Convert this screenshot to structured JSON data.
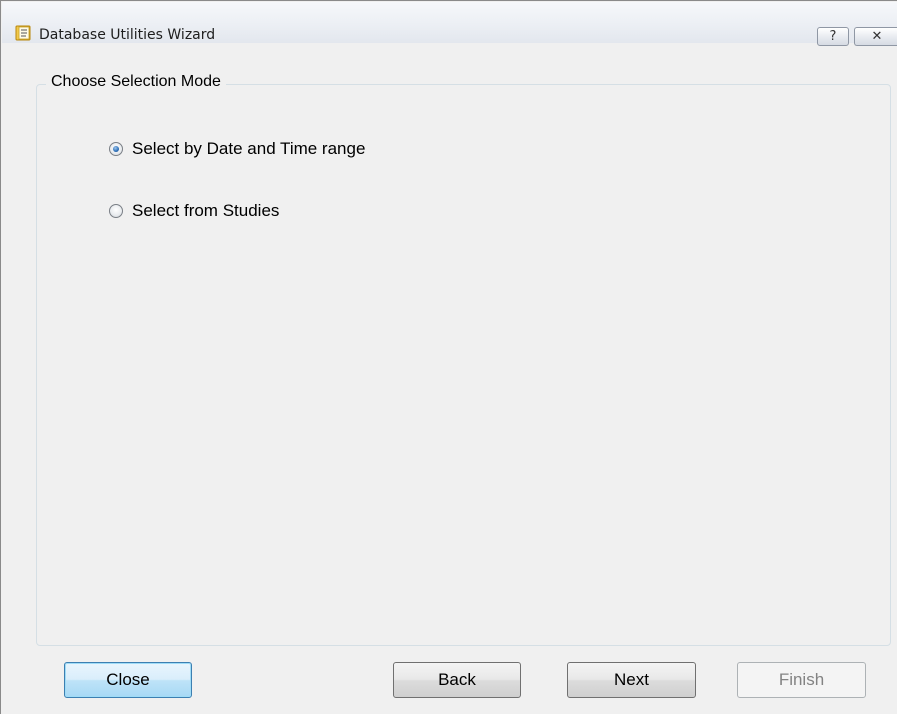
{
  "window": {
    "title": "Database Utilities Wizard",
    "help_glyph": "?",
    "close_glyph": "✕",
    "icon": "wizard-book-icon"
  },
  "group": {
    "legend": "Choose Selection Mode",
    "options": [
      {
        "label": "Select by Date and Time range",
        "checked": true
      },
      {
        "label": "Select from Studies",
        "checked": false
      }
    ]
  },
  "buttons": {
    "close": "Close",
    "back": "Back",
    "next": "Next",
    "finish": "Finish"
  },
  "colors": {
    "default_button_border": "#3c7fb1",
    "radio_dot": "#2a6db6"
  }
}
